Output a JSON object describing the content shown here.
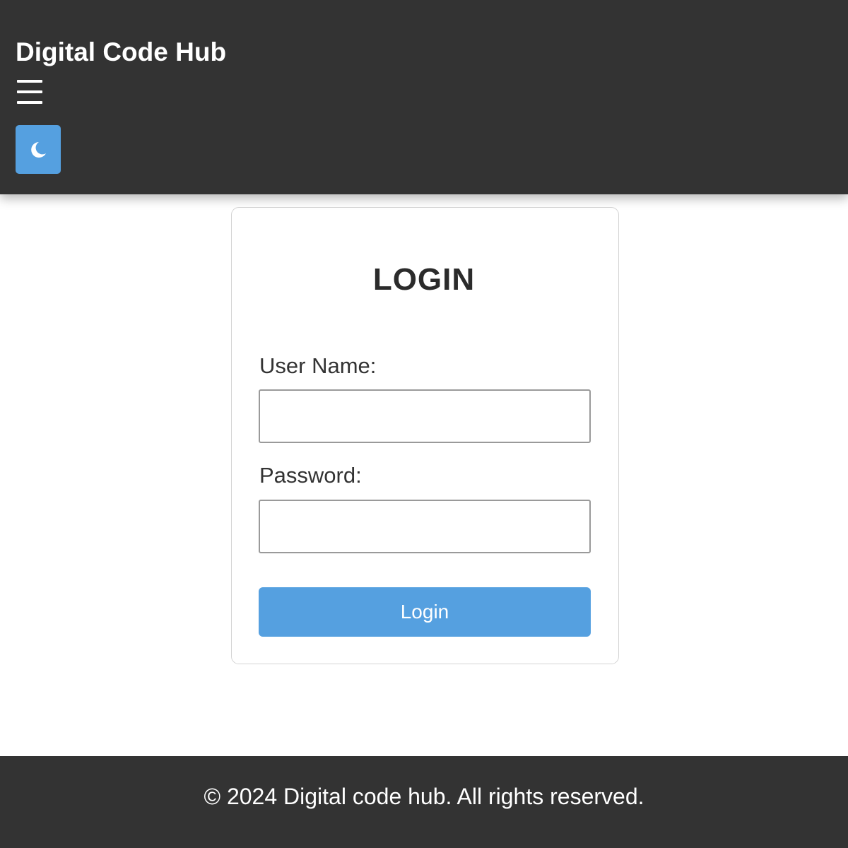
{
  "header": {
    "brand": "Digital Code Hub",
    "menu_icon": "hamburger-menu-icon",
    "theme_toggle_icon": "moon-icon",
    "background_color": "#333333",
    "accent_color": "#55a0e0"
  },
  "login": {
    "title": "LOGIN",
    "username_label": "User Name:",
    "username_value": "",
    "password_label": "Password:",
    "password_value": "",
    "submit_label": "Login"
  },
  "footer": {
    "text": "© 2024 Digital code hub. All rights reserved."
  }
}
